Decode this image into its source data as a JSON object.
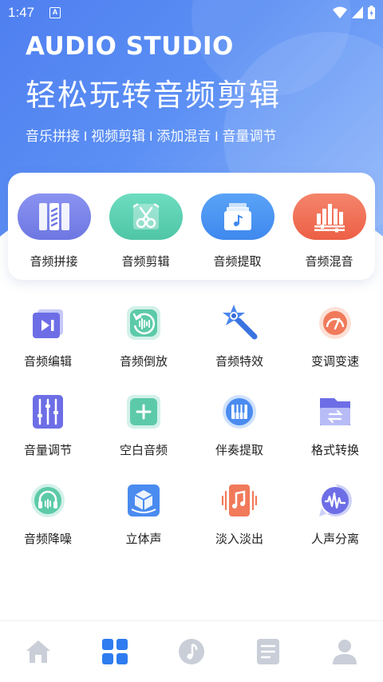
{
  "status_bar": {
    "time": "1:47",
    "notification_icon": "A"
  },
  "hero": {
    "brand": "AUDIO STUDIO",
    "headline": "轻松玩转音频剪辑",
    "tagline": "音乐拼接 I 视频剪辑 I 添加混音 I 音量调节"
  },
  "features": [
    {
      "label": "音频拼接",
      "icon": "audio-merge-icon",
      "color": "#7b84ea"
    },
    {
      "label": "音频剪辑",
      "icon": "audio-cut-icon",
      "color": "#5fd1b3"
    },
    {
      "label": "音频提取",
      "icon": "audio-extract-icon",
      "color": "#4b95f3"
    },
    {
      "label": "音频混音",
      "icon": "audio-mix-icon",
      "color": "#f27158"
    }
  ],
  "tools": [
    {
      "label": "音频编辑"
    },
    {
      "label": "音频倒放"
    },
    {
      "label": "音频特效"
    },
    {
      "label": "变调变速"
    },
    {
      "label": "音量调节"
    },
    {
      "label": "空白音频"
    },
    {
      "label": "伴奏提取"
    },
    {
      "label": "格式转换"
    },
    {
      "label": "音频降噪"
    },
    {
      "label": "立体声"
    },
    {
      "label": "淡入淡出"
    },
    {
      "label": "人声分离"
    }
  ],
  "tabbar": {
    "tabs": [
      "home-tab",
      "apps-tab",
      "music-tab",
      "document-tab",
      "profile-tab"
    ],
    "active_index": 1,
    "active_color": "#2f7cf0",
    "inactive_color": "#c9ced8"
  }
}
